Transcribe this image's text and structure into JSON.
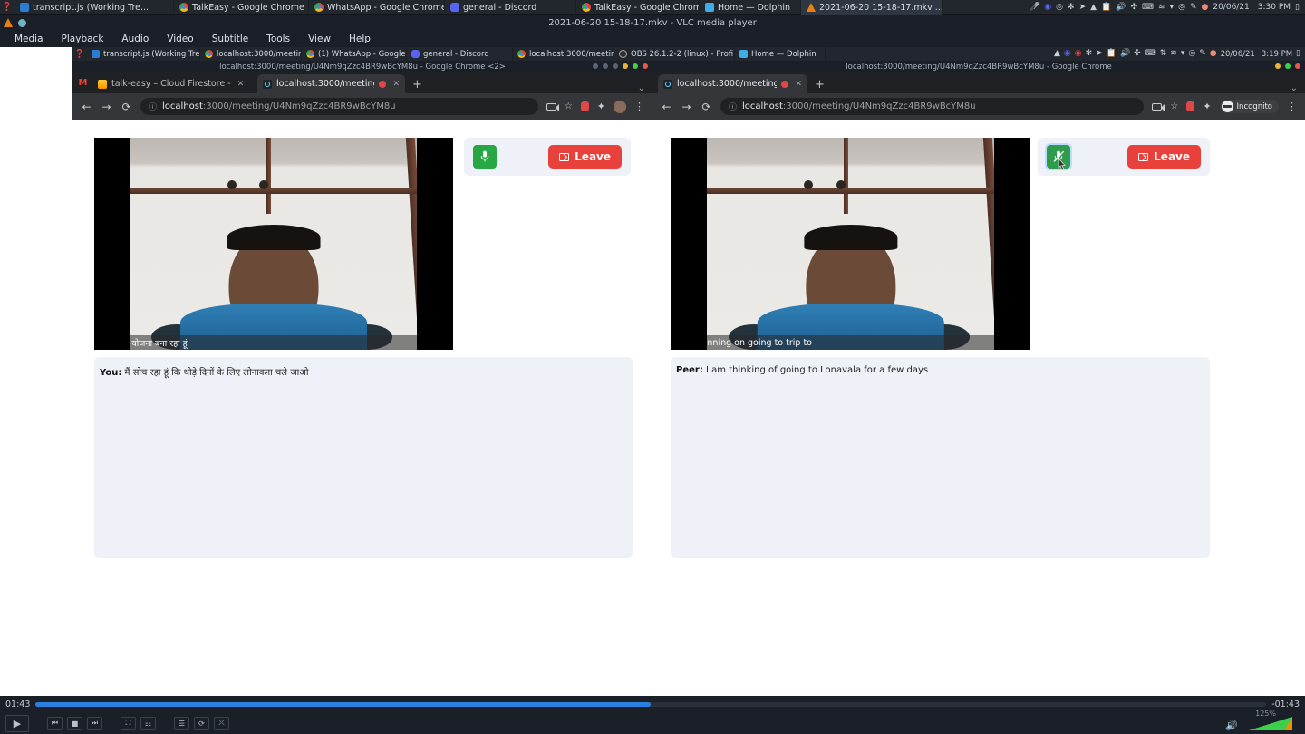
{
  "host_taskbar": {
    "tasks": [
      {
        "label": "transcript.js (Working Tre...",
        "icon": "vscode-icon"
      },
      {
        "label": "TalkEasy - Google Chrome",
        "icon": "chrome-icon"
      },
      {
        "label": "WhatsApp - Google Chrome",
        "icon": "chrome-icon"
      },
      {
        "label": "general - Discord",
        "icon": "discord-icon"
      },
      {
        "label": "TalkEasy - Google Chrome...",
        "icon": "chrome-icon"
      },
      {
        "label": "Home — Dolphin",
        "icon": "dolphin-icon"
      },
      {
        "label": "2021-06-20 15-18-17.mkv ...",
        "icon": "vlc-icon",
        "active": true
      }
    ],
    "tray_icons": [
      "mic-muted-icon",
      "discord-icon",
      "record-icon",
      "kde-icon",
      "telegram-icon",
      "vlc-icon",
      "clipboard-icon",
      "volume-icon",
      "bluetooth-icon",
      "keyboard-icon",
      "wifi-icon",
      "chevron-down-icon",
      "clock-icon",
      "pen-icon",
      "battery-icon"
    ],
    "date": "20/06/21",
    "time": "3:30 PM",
    "show_desktop": "show-desktop-icon"
  },
  "vlc": {
    "window_title": "2021-06-20 15-18-17.mkv - VLC media player",
    "menu": [
      "Media",
      "Playback",
      "Audio",
      "Video",
      "Subtitle",
      "Tools",
      "View",
      "Help"
    ],
    "elapsed": "01:43",
    "remaining": "-01:43",
    "progress_pct": 50,
    "volume": "125%",
    "buttons": [
      "play-button",
      "previous-button",
      "stop-button",
      "next-button",
      "fullscreen-button",
      "equalizer-button",
      "playlist-button",
      "loop-button",
      "shuffle-button"
    ]
  },
  "inner_taskbar": {
    "tasks": [
      {
        "label": "transcript.js (Working Tre...",
        "icon": "vscode-icon"
      },
      {
        "label": "localhost:3000/meetin...",
        "icon": "chrome-icon"
      },
      {
        "label": "(1) WhatsApp - Google ...",
        "icon": "chrome-icon"
      },
      {
        "label": "general - Discord",
        "icon": "discord-icon"
      },
      {
        "label": "localhost:3000/meetin...",
        "icon": "chrome-icon"
      },
      {
        "label": "OBS 26.1.2-2 (linux) - Profi...",
        "icon": "obs-icon"
      },
      {
        "label": "Home — Dolphin",
        "icon": "dolphin-icon"
      }
    ],
    "date": "20/06/21",
    "time": "3:19 PM"
  },
  "window_left": {
    "title": "localhost:3000/meeting/U4Nm9qZzc4BR9wBcYM8u - Google Chrome <2>",
    "tabs": [
      {
        "label": "talk-easy – Cloud Firestore - ",
        "favicon": "firebase-icon",
        "active": false
      },
      {
        "label": "localhost:3000/meeting/U",
        "favicon": "react-icon",
        "active": true,
        "recording": true
      }
    ],
    "new_tab": "+",
    "url_scheme": "localhost",
    "url_path": ":3000/meeting/U4Nm9qZzc4BR9wBcYM8u",
    "toolbar_icons": [
      "camera-icon",
      "bookmark-star-icon",
      "record-icon",
      "extensions-icon",
      "avatar-icon",
      "kebab-menu-icon"
    ],
    "meeting": {
      "caption": "मैं जाने की योजना बना रहा हूं",
      "transcript_speaker": "You:",
      "transcript_text": "मैं सोच रहा हूं कि थोड़े दिनों के लिए लोनावला चले जाओ",
      "mic_state": "unmuted",
      "mic_icon": "microphone-icon",
      "leave_label": "Leave",
      "leave_icon": "leave-door-icon"
    }
  },
  "window_right": {
    "title": "localhost:3000/meeting/U4Nm9qZzc4BR9wBcYM8u - Google Chrome",
    "tabs": [
      {
        "label": "localhost:3000/meeting/U",
        "favicon": "react-icon",
        "active": true,
        "recording": true
      }
    ],
    "new_tab": "+",
    "url_scheme": "localhost",
    "url_path": ":3000/meeting/U4Nm9qZzc4BR9wBcYM8u",
    "profile_label": "Incognito",
    "toolbar_icons": [
      "camera-icon",
      "bookmark-star-icon",
      "record-icon",
      "extensions-icon",
      "incognito-icon",
      "kebab-menu-icon"
    ],
    "meeting": {
      "caption": "I am planning on going to trip to",
      "transcript_speaker": "Peer:",
      "transcript_text": "I am thinking of going to Lonavala for a few days",
      "mic_state": "muted",
      "mic_icon": "microphone-muted-icon",
      "leave_label": "Leave",
      "leave_icon": "leave-door-icon"
    }
  },
  "colors": {
    "mic_green": "#28a745",
    "leave_red": "#e8403a",
    "transcript_bg": "#eef1f8",
    "taskbar_bg": "#22272e",
    "seek_blue": "#2a7fe0"
  }
}
